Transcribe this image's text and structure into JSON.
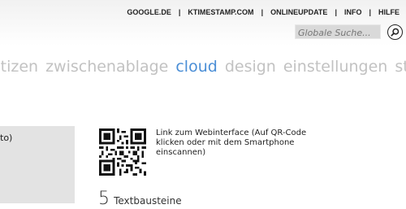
{
  "header": {
    "links": [
      "GOOGLE.DE",
      "KTIMESTAMP.COM",
      "ONLINEUPDATE",
      "INFO",
      "HILFE"
    ],
    "search_placeholder": "Globale Suche..."
  },
  "nav": {
    "items": [
      "otizen",
      "zwischenablage",
      "cloud",
      "design",
      "einstellungen",
      "sta"
    ],
    "active": "cloud"
  },
  "left_panel": {
    "text": "to)"
  },
  "cloud": {
    "qr_caption_lines": [
      "Link zum Webinterface (Auf QR-Code",
      "klicken oder mit dem Smartphone",
      "einscannen)"
    ],
    "textbausteine_count": "5",
    "textbausteine_label": "Textbausteine"
  },
  "colors": {
    "accent": "#4a8ed6",
    "nav_inactive": "#c2c2c2",
    "panel": "#e3e3e3"
  }
}
